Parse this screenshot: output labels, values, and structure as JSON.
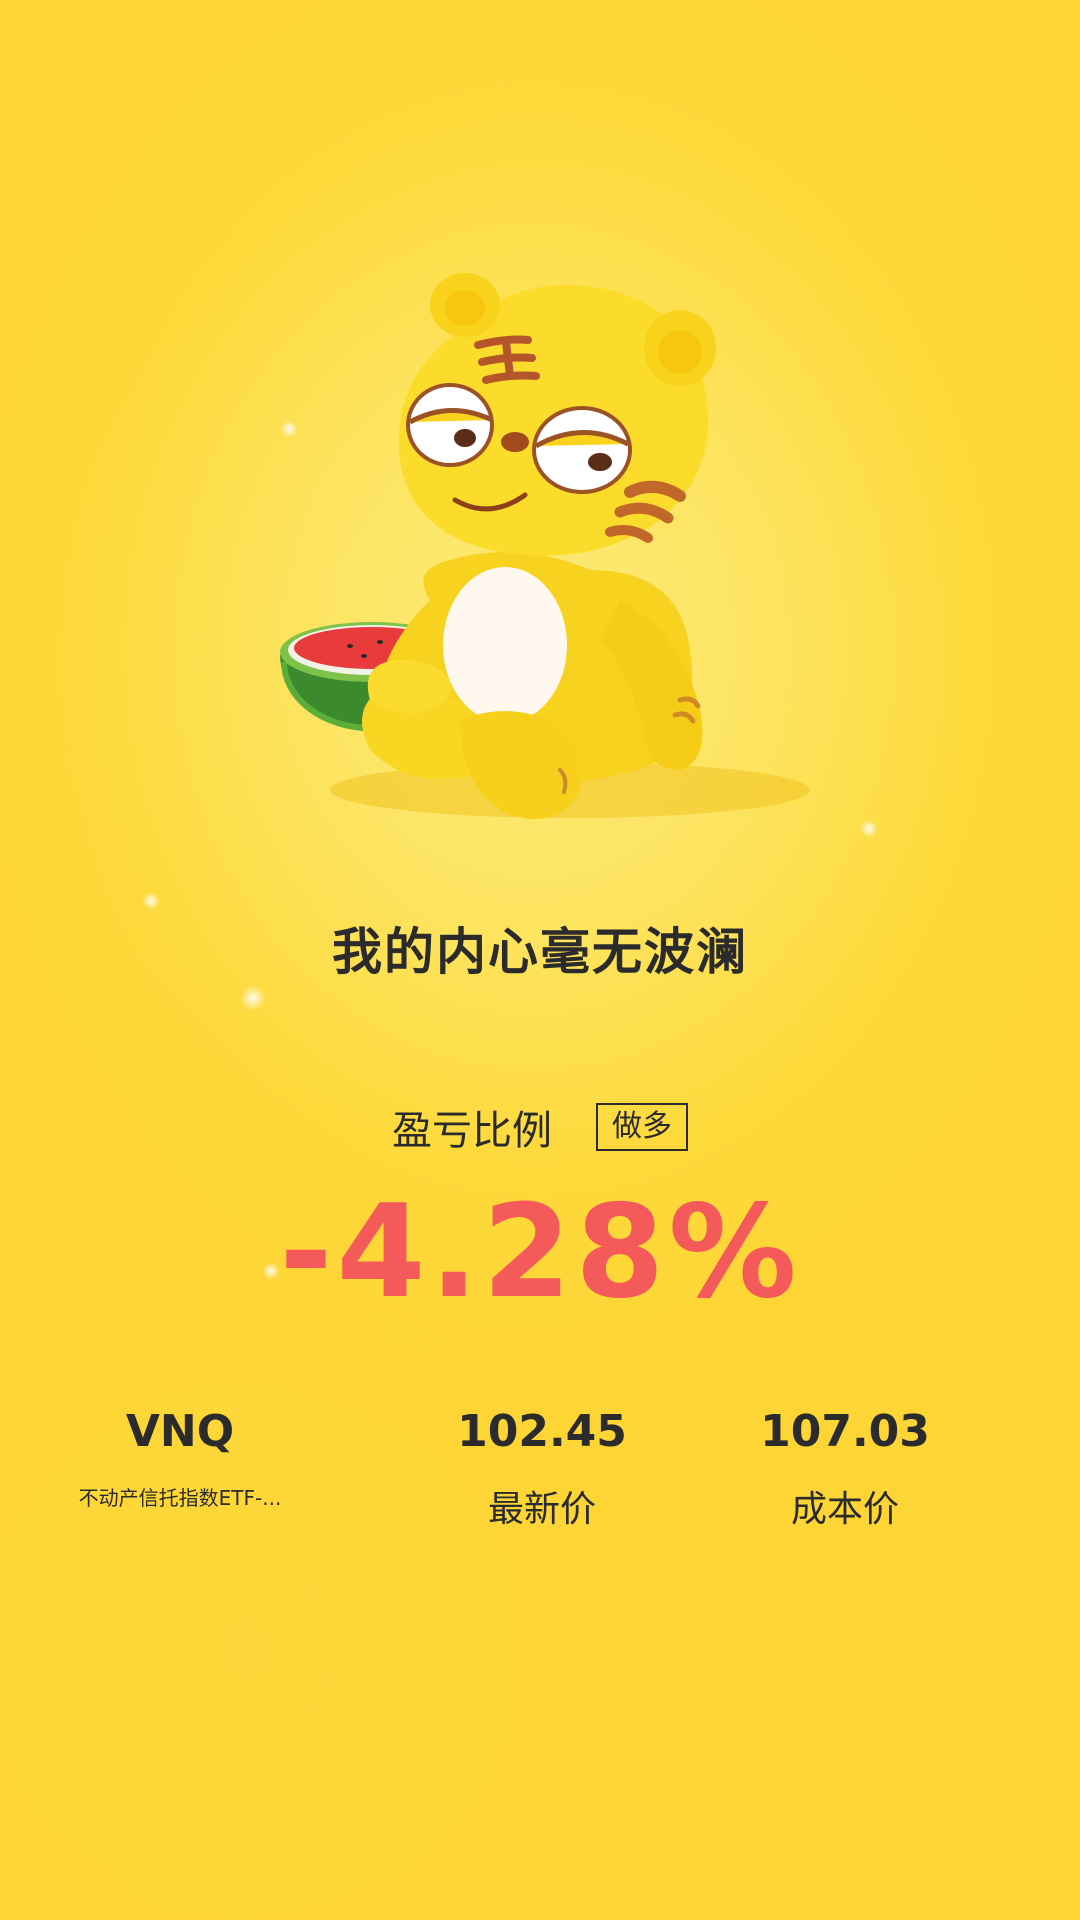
{
  "headline": "我的内心毫无波澜",
  "ratio": {
    "label": "盈亏比例",
    "direction": "做多",
    "value": "-4.28%"
  },
  "stats": {
    "symbol": "VNQ",
    "symbol_name": "不动产信托指数ETF-...",
    "latest_price": "102.45",
    "latest_label": "最新价",
    "cost_price": "107.03",
    "cost_label": "成本价"
  },
  "colors": {
    "background": "#fdd93a",
    "loss_red": "#f45a5a",
    "text_dark": "#2b2b2b"
  },
  "icons": {
    "mascot": "tiger-mascot-illustration",
    "watermelon": "watermelon-icon"
  }
}
